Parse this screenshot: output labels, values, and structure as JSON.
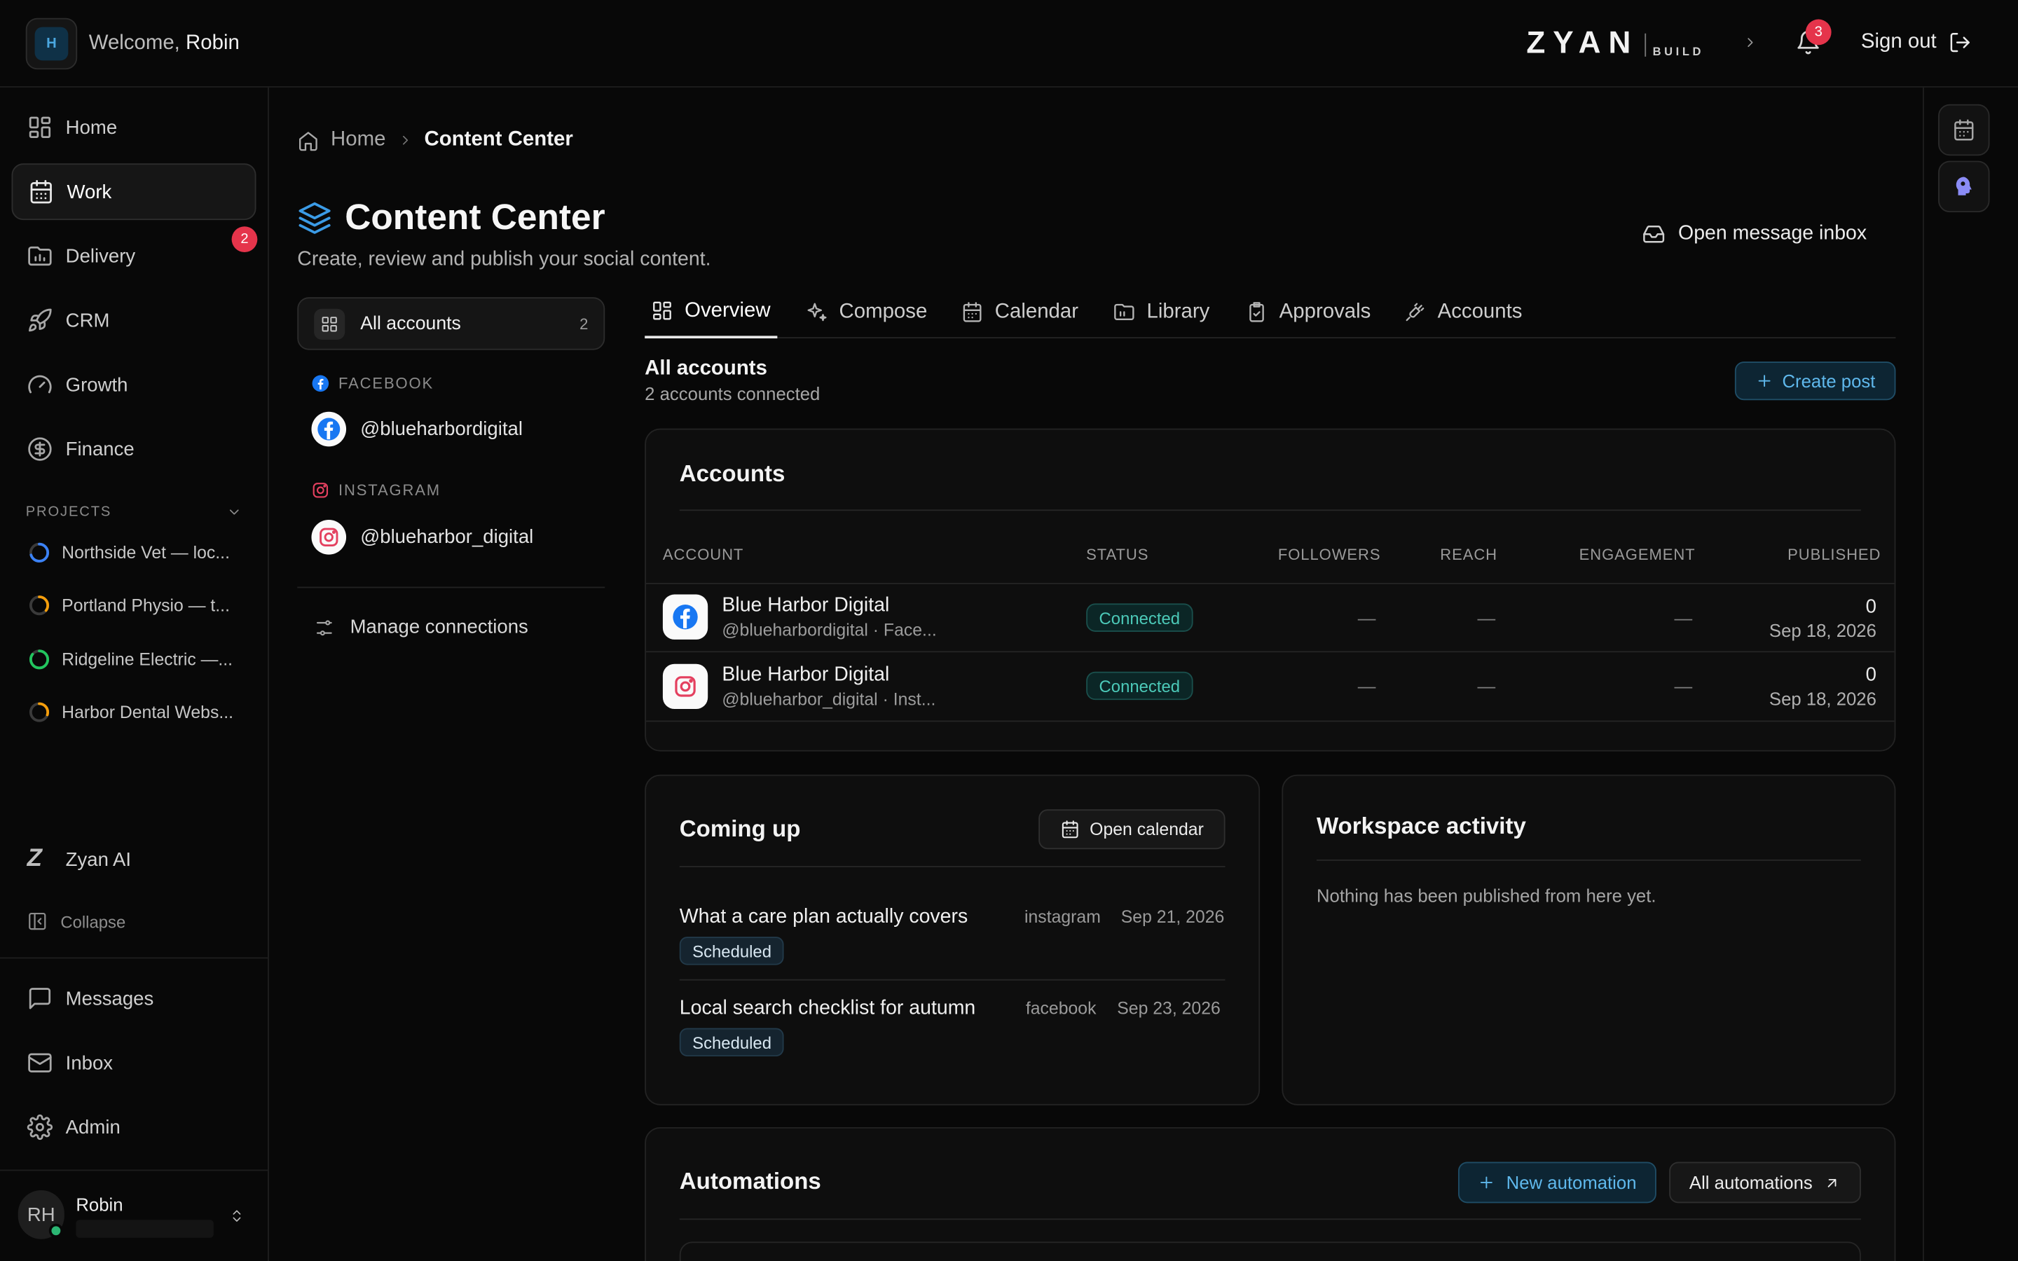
{
  "header": {
    "workspace_initial": "H",
    "welcome_prefix": "Welcome,",
    "user_first_name": "Robin",
    "logo_mark": "ZYAN",
    "logo_sub": "BUILD",
    "notifications_count": "3",
    "sign_out_label": "Sign out"
  },
  "sidebar": {
    "nav": [
      {
        "label": "Home",
        "icon": "grid-icon"
      },
      {
        "label": "Work",
        "icon": "calendar-icon"
      },
      {
        "label": "Delivery",
        "icon": "folder-chart-icon"
      },
      {
        "label": "CRM",
        "icon": "rocket-icon"
      },
      {
        "label": "Growth",
        "icon": "gauge-icon"
      },
      {
        "label": "Finance",
        "icon": "dollar-icon"
      }
    ],
    "work_badge": "2",
    "projects_heading": "PROJECTS",
    "projects": [
      {
        "label": "Northside Vet — loc...",
        "color": "#3b82f6",
        "progress": 0.7
      },
      {
        "label": "Portland Physio — t...",
        "color": "#f59e0b",
        "progress": 0.35
      },
      {
        "label": "Ridgeline Electric —...",
        "color": "#22c55e",
        "progress": 0.85
      },
      {
        "label": "Harbor Dental Webs...",
        "color": "#f59e0b",
        "progress": 0.3
      }
    ],
    "zyan_ai_label": "Zyan AI",
    "collapse_label": "Collapse",
    "bottom_nav": [
      {
        "label": "Messages",
        "icon": "chat-icon"
      },
      {
        "label": "Inbox",
        "icon": "mail-icon"
      },
      {
        "label": "Admin",
        "icon": "gear-icon"
      }
    ],
    "user": {
      "initials": "RH",
      "name": "Robin"
    }
  },
  "breadcrumb": {
    "home": "Home",
    "current": "Content Center"
  },
  "page": {
    "title": "Content Center",
    "subtitle": "Create, review and publish your social content.",
    "open_inbox_label": "Open message inbox"
  },
  "account_filter": {
    "all_label": "All accounts",
    "all_count": "2",
    "groups": [
      {
        "network": "FACEBOOK",
        "handle": "@blueharbordigital"
      },
      {
        "network": "INSTAGRAM",
        "handle": "@blueharbor_digital"
      }
    ],
    "manage_label": "Manage connections"
  },
  "tabs": [
    "Overview",
    "Compose",
    "Calendar",
    "Library",
    "Approvals",
    "Accounts"
  ],
  "overview": {
    "title": "All accounts",
    "subtitle": "2 accounts connected",
    "create_post_label": "Create post"
  },
  "accounts_card": {
    "title": "Accounts",
    "columns": [
      "ACCOUNT",
      "STATUS",
      "FOLLOWERS",
      "REACH",
      "ENGAGEMENT",
      "PUBLISHED"
    ],
    "rows": [
      {
        "name": "Blue Harbor Digital",
        "handle": "@blueharbordigital · Face...",
        "status": "Connected",
        "followers": "—",
        "reach": "—",
        "engagement": "—",
        "published": "0",
        "date": "Sep 18, 2026"
      },
      {
        "name": "Blue Harbor Digital",
        "handle": "@blueharbor_digital · Inst...",
        "status": "Connected",
        "followers": "—",
        "reach": "—",
        "engagement": "—",
        "published": "0",
        "date": "Sep 18, 2026"
      }
    ]
  },
  "coming_up": {
    "title": "Coming up",
    "open_calendar_label": "Open calendar",
    "items": [
      {
        "title": "What a care plan actually covers",
        "network": "instagram",
        "date": "Sep 21, 2026",
        "status": "Scheduled"
      },
      {
        "title": "Local search checklist for autumn",
        "network": "facebook",
        "date": "Sep 23, 2026",
        "status": "Scheduled"
      }
    ]
  },
  "workspace_activity": {
    "title": "Workspace activity",
    "empty": "Nothing has been published from here yet."
  },
  "automations": {
    "title": "Automations",
    "new_label": "New automation",
    "all_label": "All automations"
  },
  "colors": {
    "accent": "#3b9be6",
    "badge": "#e5344b",
    "connected": "#4cc9b8",
    "facebook": "#1877f2",
    "instagram": "#e4405f"
  }
}
